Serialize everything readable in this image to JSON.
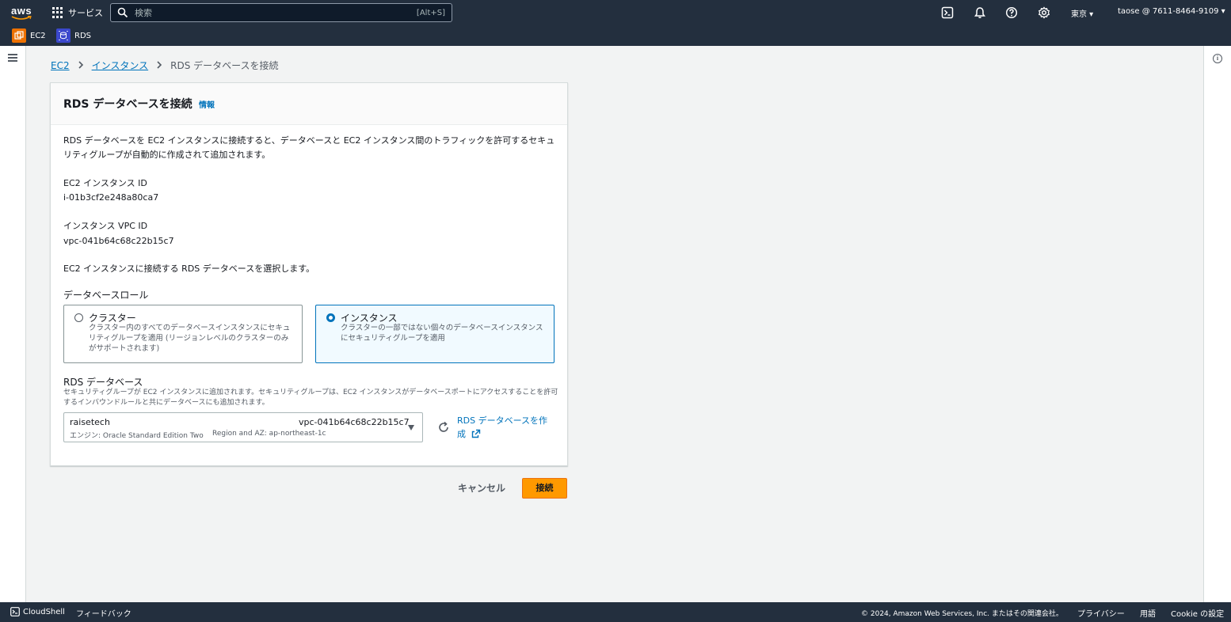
{
  "topnav": {
    "logo": "aws",
    "services_label": "サービス",
    "search_placeholder": "検索",
    "search_shortcut": "[Alt+S]",
    "region": "東京 ▾",
    "account": "taose @ 7611-8464-9109 ▾",
    "favorites": [
      {
        "label": "EC2",
        "icon": "ec2-icon",
        "color": "#ed7100"
      },
      {
        "label": "RDS",
        "icon": "rds-icon",
        "color": "#3b48cc"
      }
    ],
    "icons": [
      "cloudshell-icon",
      "bell-icon",
      "help-icon",
      "settings-icon"
    ]
  },
  "breadcrumb": {
    "items": [
      "EC2",
      "インスタンス"
    ],
    "current": "RDS データベースを接続"
  },
  "panel": {
    "title": "RDS データベースを接続",
    "info_link": "情報",
    "description": "RDS データベースを EC2 インスタンスに接続すると、データベースと EC2 インスタンス間のトラフィックを許可するセキュリティグループが自動的に作成されて追加されます。",
    "instance_id_label": "EC2 インスタンス ID",
    "instance_id_value": "i-01b3cf2e248a80ca7",
    "vpc_id_label": "インスタンス VPC ID",
    "vpc_id_value": "vpc-041b64c68c22b15c7",
    "select_prompt": "EC2 インスタンスに接続する RDS データベースを選択します。",
    "role_label": "データベースロール",
    "roles": [
      {
        "title": "クラスター",
        "desc": "クラスター内のすべてのデータベースインスタンスにセキュリティグループを適用 (リージョンレベルのクラスターのみがサポートされます)",
        "selected": false
      },
      {
        "title": "インスタンス",
        "desc": "クラスターの一部ではない個々のデータベースインスタンスにセキュリティグループを適用",
        "selected": true
      }
    ],
    "rds_label": "RDS データベース",
    "rds_desc": "セキュリティグループが EC2 インスタンスに追加されます。セキュリティグループは、EC2 インスタンスがデータベースポートにアクセスすることを許可するインバウンドルールと共にデータベースにも追加されます。",
    "rds_select": {
      "name": "raisetech",
      "vpc": "vpc-041b64c68c22b15c7",
      "engine": "エンジン: Oracle Standard Edition Two",
      "region_az": "Region and AZ: ap-northeast-1c"
    },
    "create_link": "RDS データベースを作成"
  },
  "actions": {
    "cancel": "キャンセル",
    "connect": "接続"
  },
  "footer": {
    "cloudshell": "CloudShell",
    "feedback": "フィードバック",
    "copyright": "© 2024, Amazon Web Services, Inc. またはその関連会社。",
    "privacy": "プライバシー",
    "terms": "用語",
    "cookie": "Cookie の設定"
  },
  "colors": {
    "nav_bg": "#232f3e",
    "link": "#0073bb",
    "primary_button": "#ff9900"
  }
}
